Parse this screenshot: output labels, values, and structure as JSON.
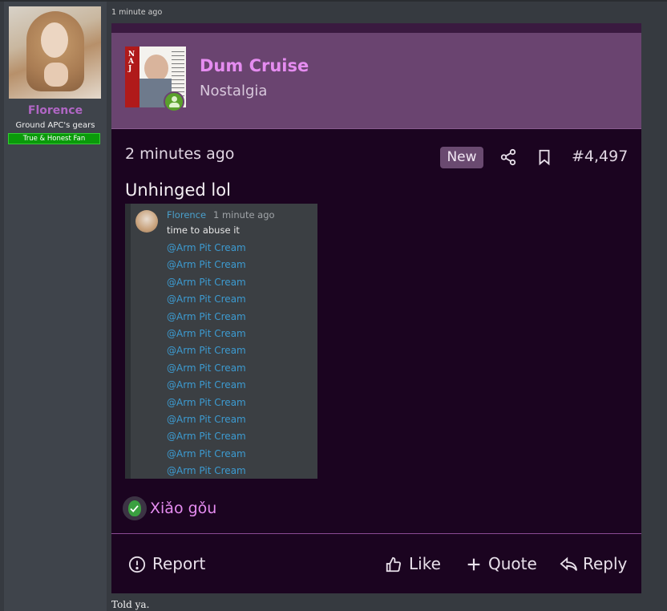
{
  "post_header": {
    "timestamp": "1 minute ago"
  },
  "user": {
    "name": "Florence",
    "title": "Ground APC's gears",
    "banner": "True & Honest Fan"
  },
  "embed": {
    "thread_title": "Dum Cruise",
    "forum": "Nostalgia",
    "post_time": "2 minutes ago",
    "new_badge": "New",
    "post_number": "#4,497",
    "text": "Unhinged lol",
    "screenshot": {
      "author": "Florence",
      "time": "1 minute ago",
      "message": "time to abuse it",
      "mentions": [
        "@Arm Pit Cream",
        "@Arm Pit Cream",
        "@Arm Pit Cream",
        "@Arm Pit Cream",
        "@Arm Pit Cream",
        "@Arm Pit Cream",
        "@Arm Pit Cream",
        "@Arm Pit Cream",
        "@Arm Pit Cream",
        "@Arm Pit Cream",
        "@Arm Pit Cream",
        "@Arm Pit Cream",
        "@Arm Pit Cream",
        "@Arm Pit Cream"
      ]
    },
    "reaction_user": "Xiǎo gǒu",
    "actions": {
      "report": "Report",
      "like": "Like",
      "quote": "Quote",
      "reply": "Reply"
    }
  },
  "post_body": "Told ya.",
  "icons": [
    "share-icon",
    "bookmark-icon",
    "report-icon",
    "like-icon",
    "quote-icon",
    "reply-icon",
    "user-icon"
  ],
  "colors": {
    "accent": "#e58cf0",
    "username": "#b066c4",
    "embed_bg": "#1b0420",
    "header_bg": "#6a4470",
    "banner": "#0a9a0a"
  }
}
